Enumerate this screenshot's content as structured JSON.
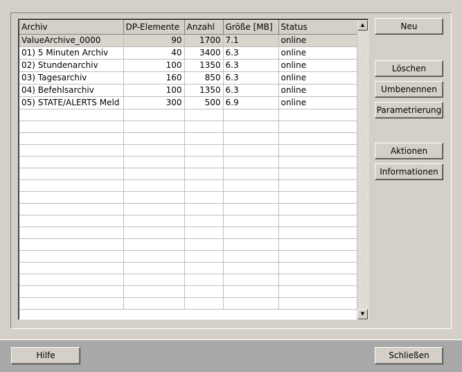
{
  "table": {
    "headers": [
      "Archiv",
      "DP-Elemente",
      "Anzahl",
      "Größe [MB]",
      "Status"
    ],
    "rows": [
      [
        "ValueArchive_0000",
        "90",
        "1700",
        "7.1",
        "online"
      ],
      [
        "01) 5 Minuten Archiv",
        "40",
        "3400",
        "6.3",
        "online"
      ],
      [
        "02) Stundenarchiv",
        "100",
        "1350",
        "6.3",
        "online"
      ],
      [
        "03) Tagesarchiv",
        "160",
        "850",
        "6.3",
        "online"
      ],
      [
        "04) Befehlsarchiv",
        "100",
        "1350",
        "6.3",
        "online"
      ],
      [
        "05) STATE/ALERTS Meld",
        "300",
        "500",
        "6.9",
        "online"
      ]
    ],
    "selected_row": 0,
    "empty_rows": 17
  },
  "buttons": {
    "neu": "Neu",
    "loeschen": "Löschen",
    "umbenennen": "Umbenennen",
    "parametrierung": "Parametrierung",
    "aktionen": "Aktionen",
    "informationen": "Informationen",
    "hilfe": "Hilfe",
    "schliessen": "Schließen"
  },
  "colors": {
    "panel": "#d4d0c8",
    "footer": "#a8a8a8",
    "selected_row": "#d9d5cd"
  }
}
